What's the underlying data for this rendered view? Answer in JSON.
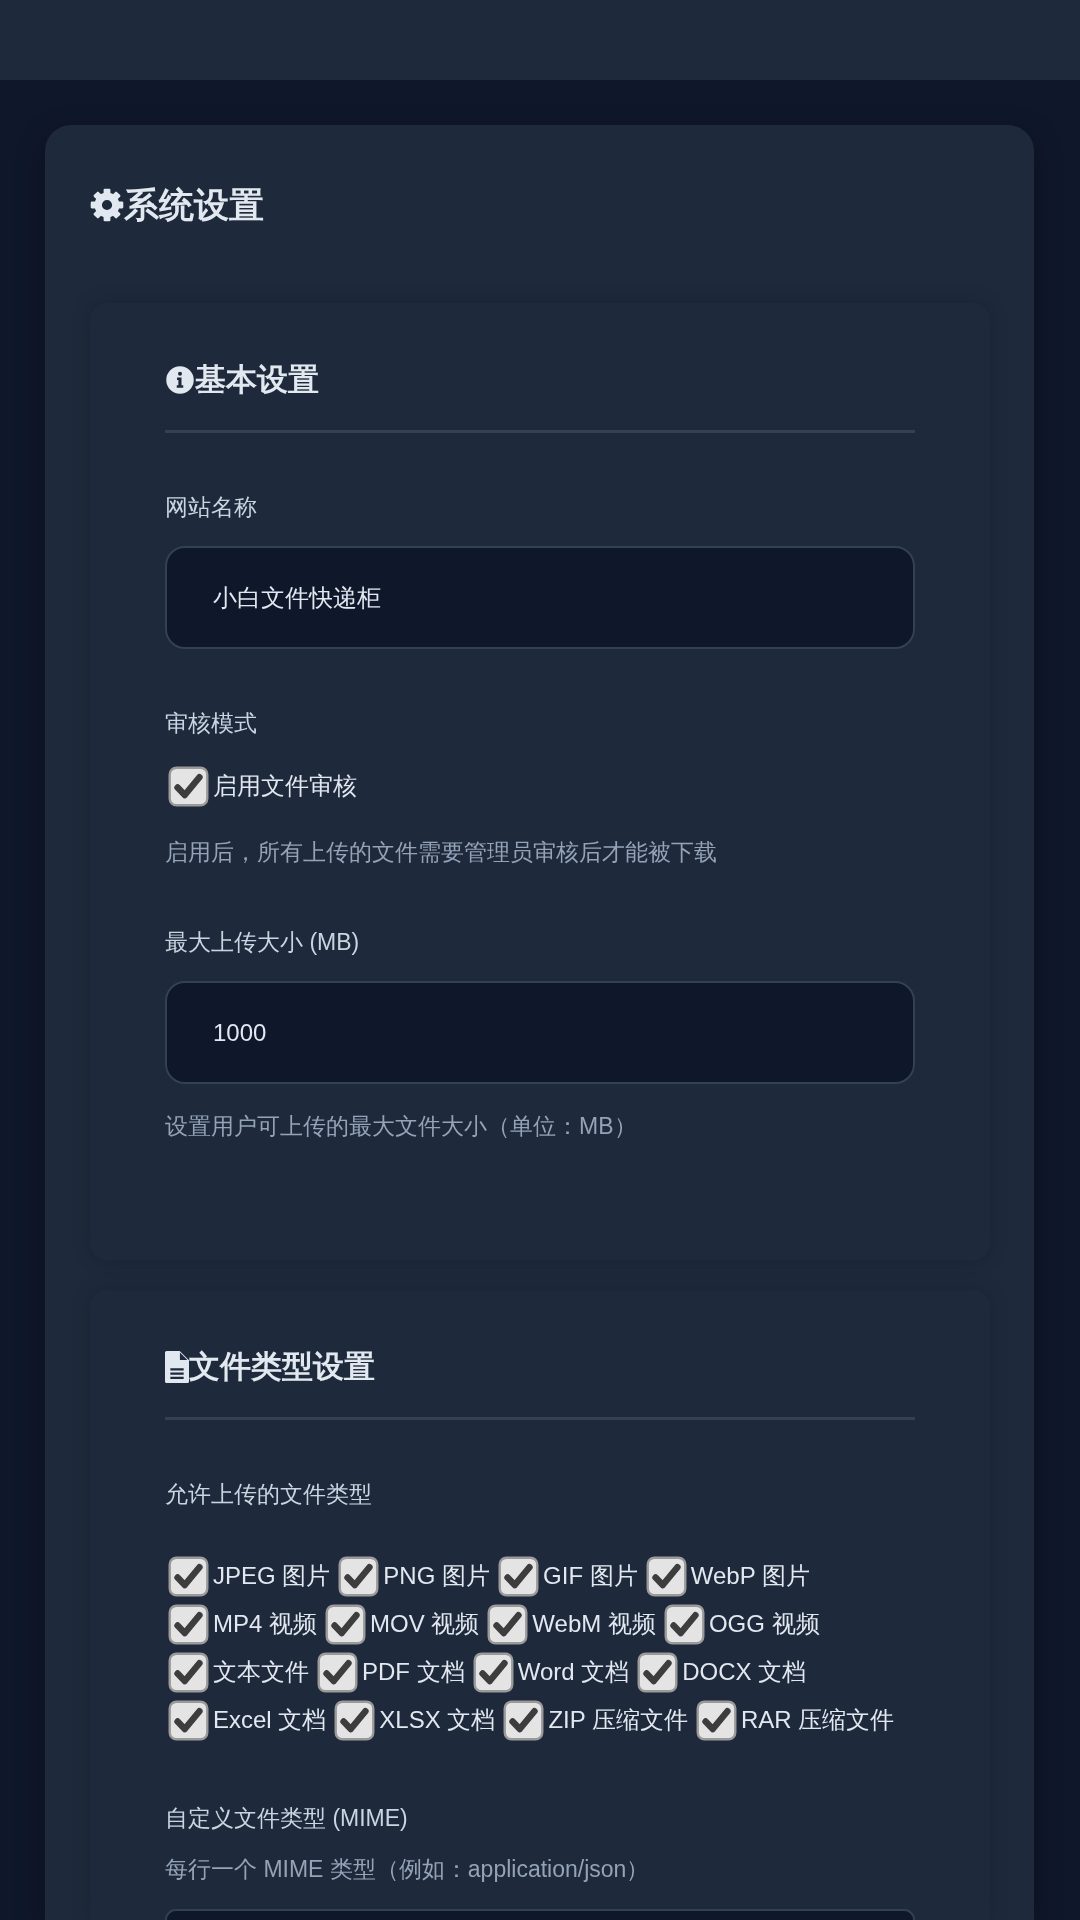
{
  "page": {
    "title": "系统设置"
  },
  "sections": [
    {
      "kind": "basic",
      "title": "基本设置",
      "fields": [
        {
          "kind": "text",
          "label": "网站名称",
          "value": "小白文件快递柜"
        },
        {
          "kind": "checkbox",
          "label": "审核模式",
          "option": {
            "label": "启用文件审核",
            "checked": true
          },
          "hint": "启用后，所有上传的文件需要管理员审核后才能被下载"
        },
        {
          "kind": "text",
          "label": "最大上传大小 (MB)",
          "value": "1000",
          "hint": "设置用户可上传的最大文件大小（单位：MB）"
        }
      ]
    },
    {
      "kind": "file_types",
      "title": "文件类型设置",
      "fields": [
        {
          "kind": "checkbox_group",
          "label": "允许上传的文件类型",
          "options": [
            {
              "label": "JPEG 图片",
              "checked": true
            },
            {
              "label": "PNG 图片",
              "checked": true
            },
            {
              "label": "GIF 图片",
              "checked": true
            },
            {
              "label": "WebP 图片",
              "checked": true
            },
            {
              "label": "MP4 视频",
              "checked": true
            },
            {
              "label": "MOV 视频",
              "checked": true
            },
            {
              "label": "WebM 视频",
              "checked": true
            },
            {
              "label": "OGG 视频",
              "checked": true
            },
            {
              "label": "文本文件",
              "checked": true
            },
            {
              "label": "PDF 文档",
              "checked": true
            },
            {
              "label": "Word 文档",
              "checked": true
            },
            {
              "label": "DOCX 文档",
              "checked": true
            },
            {
              "label": "Excel 文档",
              "checked": true
            },
            {
              "label": "XLSX 文档",
              "checked": true
            },
            {
              "label": "ZIP 压缩文件",
              "checked": true
            },
            {
              "label": "RAR 压缩文件",
              "checked": true
            }
          ]
        },
        {
          "kind": "textarea",
          "label": "自定义文件类型 (MIME)",
          "hint": "每行一个 MIME 类型（例如：application/json）"
        }
      ]
    }
  ]
}
